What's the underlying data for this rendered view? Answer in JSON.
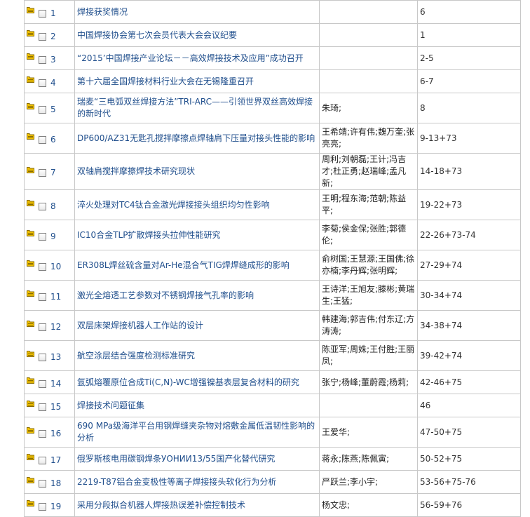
{
  "colors": {
    "link": "#1f4e8c",
    "border": "#c8c8c8",
    "icon_fill": "#f2c200"
  },
  "icons": {
    "row_icon": "folder-icon",
    "row_checkbox": "checkbox-unchecked"
  },
  "articles": [
    {
      "num": "1",
      "title": "焊接获奖情况",
      "author": "",
      "pages": "6"
    },
    {
      "num": "2",
      "title": "中国焊接协会第七次会员代表大会会议纪要",
      "author": "",
      "pages": "1"
    },
    {
      "num": "3",
      "title": "“2015’中国焊接产业论坛－－高效焊接技术及应用”成功召开",
      "author": "",
      "pages": "2-5"
    },
    {
      "num": "4",
      "title": "第十六届全国焊接材料行业大会在无锡隆重召开",
      "author": "",
      "pages": "6-7"
    },
    {
      "num": "5",
      "title": "瑞麦“三电弧双丝焊接方法”TRI-ARC——引领世界双丝高效焊接的新时代",
      "author": "朱琦;",
      "pages": "8"
    },
    {
      "num": "6",
      "title": "DP600/AZ31无匙孔搅拌摩擦点焊轴肩下压量对接头性能的影响",
      "author": "王希靖;许有伟;魏万奎;张亮亮;",
      "pages": "9-13+73"
    },
    {
      "num": "7",
      "title": "双轴肩搅拌摩擦焊技术研究现状",
      "author": "周利;刘朝磊;王计;冯吉才;杜正勇;赵瑞峰;孟凡新;",
      "pages": "14-18+73"
    },
    {
      "num": "8",
      "title": "淬火处理对TC4钛合金激光焊接接头组织均匀性影响",
      "author": "王明;程东海;范朝;陈益平;",
      "pages": "19-22+73"
    },
    {
      "num": "9",
      "title": "IC10合金TLP扩散焊接头拉伸性能研究",
      "author": "李菊;侯金保;张胜;郭德伦;",
      "pages": "22-26+73-74"
    },
    {
      "num": "10",
      "title": "ER308L焊丝硫含量对Ar-He混合气TIG焊焊缝成形的影响",
      "author": "俞树国;王慧源;王国佛;徐亦楠;李丹辉;张明辉;",
      "pages": "27-29+74"
    },
    {
      "num": "11",
      "title": "激光全熔透工艺参数对不锈钢焊接气孔率的影响",
      "author": "王诗洋;王旭友;滕彬;黄瑞生;王猛;",
      "pages": "30-34+74"
    },
    {
      "num": "12",
      "title": "双层床架焊接机器人工作站的设计",
      "author": "韩建海;郭吉伟;付东辽;方涛涛;",
      "pages": "34-38+74"
    },
    {
      "num": "13",
      "title": "航空涂层结合强度检测标准研究",
      "author": "陈亚军;周姝;王付胜;王丽凤;",
      "pages": "39-42+74"
    },
    {
      "num": "14",
      "title": "氩弧熔覆原位合成Ti(C,N)-WC增强镍基表层复合材料的研究",
      "author": "张宁;杨峰;董蔚霞;杨莉;",
      "pages": "42-46+75"
    },
    {
      "num": "15",
      "title": "焊接技术问题征集",
      "author": "",
      "pages": "46"
    },
    {
      "num": "16",
      "title": "690 MPa级海洋平台用钢焊缝夹杂物对熔敷金属低温韧性影响的分析",
      "author": "王爱华;",
      "pages": "47-50+75"
    },
    {
      "num": "17",
      "title": "俄罗斯核电用碳钢焊条УОНИИ13/55国产化替代研究",
      "author": "蒋永;陈燕;陈佩寅;",
      "pages": "50-52+75"
    },
    {
      "num": "18",
      "title": "2219-T87铝合金变极性等离子焊接接头软化行为分析",
      "author": "严跃兰;李小宇;",
      "pages": "53-56+75-76"
    },
    {
      "num": "19",
      "title": "采用分段拟合机器人焊接热误差补偿控制技术",
      "author": "杨文忠;",
      "pages": "56-59+76"
    }
  ]
}
